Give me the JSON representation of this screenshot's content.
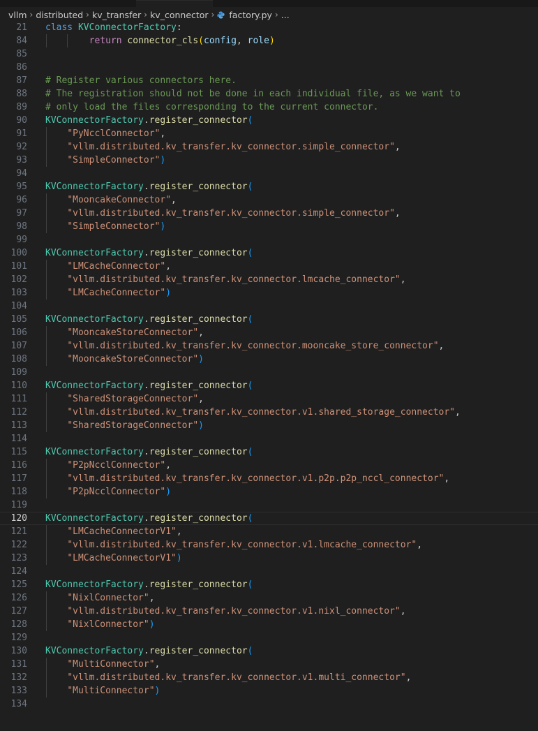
{
  "breadcrumb": [
    "vllm",
    "distributed",
    "kv_transfer",
    "kv_connector",
    "factory.py",
    "..."
  ],
  "colors": {
    "keyword": "#569cd6",
    "control_keyword": "#c586c0",
    "class": "#4ec9b0",
    "function": "#dcdcaa",
    "variable": "#9cdcfe",
    "string": "#ce9178",
    "comment": "#6a9955",
    "background": "#1f1f1f"
  },
  "active_line": "120",
  "sticky": [
    {
      "n": "21",
      "t": [
        [
          "kw",
          "class "
        ],
        [
          "cls",
          "KVConnectorFactory"
        ],
        [
          "txt",
          ":"
        ]
      ]
    },
    {
      "n": "84",
      "t": [
        [
          "txt",
          "        "
        ],
        [
          "kwc",
          "return "
        ],
        [
          "fn",
          "connector_cls"
        ],
        [
          "p0",
          "("
        ],
        [
          "var",
          "config"
        ],
        [
          "txt",
          ", "
        ],
        [
          "var",
          "role"
        ],
        [
          "p0",
          ")"
        ]
      ]
    }
  ],
  "lines": [
    {
      "n": "85",
      "t": []
    },
    {
      "n": "86",
      "t": []
    },
    {
      "n": "87",
      "t": [
        [
          "cmt",
          "# Register various connectors here."
        ]
      ]
    },
    {
      "n": "88",
      "t": [
        [
          "cmt",
          "# The registration should not be done in each individual file, as we want to"
        ]
      ]
    },
    {
      "n": "89",
      "t": [
        [
          "cmt",
          "# only load the files corresponding to the current connector."
        ]
      ]
    },
    {
      "n": "90",
      "t": [
        [
          "cls",
          "KVConnectorFactory"
        ],
        [
          "txt",
          "."
        ],
        [
          "fn",
          "register_connector"
        ],
        [
          "p2",
          "("
        ]
      ]
    },
    {
      "n": "91",
      "t": [
        [
          "txt",
          "    "
        ],
        [
          "str",
          "\"PyNcclConnector\""
        ],
        [
          "txt",
          ","
        ]
      ]
    },
    {
      "n": "92",
      "t": [
        [
          "txt",
          "    "
        ],
        [
          "str",
          "\"vllm.distributed.kv_transfer.kv_connector.simple_connector\""
        ],
        [
          "txt",
          ","
        ]
      ]
    },
    {
      "n": "93",
      "t": [
        [
          "txt",
          "    "
        ],
        [
          "str",
          "\"SimpleConnector\""
        ],
        [
          "p2",
          ")"
        ]
      ]
    },
    {
      "n": "94",
      "t": []
    },
    {
      "n": "95",
      "t": [
        [
          "cls",
          "KVConnectorFactory"
        ],
        [
          "txt",
          "."
        ],
        [
          "fn",
          "register_connector"
        ],
        [
          "p2",
          "("
        ]
      ]
    },
    {
      "n": "96",
      "t": [
        [
          "txt",
          "    "
        ],
        [
          "str",
          "\"MooncakeConnector\""
        ],
        [
          "txt",
          ","
        ]
      ]
    },
    {
      "n": "97",
      "t": [
        [
          "txt",
          "    "
        ],
        [
          "str",
          "\"vllm.distributed.kv_transfer.kv_connector.simple_connector\""
        ],
        [
          "txt",
          ","
        ]
      ]
    },
    {
      "n": "98",
      "t": [
        [
          "txt",
          "    "
        ],
        [
          "str",
          "\"SimpleConnector\""
        ],
        [
          "p2",
          ")"
        ]
      ]
    },
    {
      "n": "99",
      "t": []
    },
    {
      "n": "100",
      "t": [
        [
          "cls",
          "KVConnectorFactory"
        ],
        [
          "txt",
          "."
        ],
        [
          "fn",
          "register_connector"
        ],
        [
          "p2",
          "("
        ]
      ]
    },
    {
      "n": "101",
      "t": [
        [
          "txt",
          "    "
        ],
        [
          "str",
          "\"LMCacheConnector\""
        ],
        [
          "txt",
          ","
        ]
      ]
    },
    {
      "n": "102",
      "t": [
        [
          "txt",
          "    "
        ],
        [
          "str",
          "\"vllm.distributed.kv_transfer.kv_connector.lmcache_connector\""
        ],
        [
          "txt",
          ","
        ]
      ]
    },
    {
      "n": "103",
      "t": [
        [
          "txt",
          "    "
        ],
        [
          "str",
          "\"LMCacheConnector\""
        ],
        [
          "p2",
          ")"
        ]
      ]
    },
    {
      "n": "104",
      "t": []
    },
    {
      "n": "105",
      "t": [
        [
          "cls",
          "KVConnectorFactory"
        ],
        [
          "txt",
          "."
        ],
        [
          "fn",
          "register_connector"
        ],
        [
          "p2",
          "("
        ]
      ]
    },
    {
      "n": "106",
      "t": [
        [
          "txt",
          "    "
        ],
        [
          "str",
          "\"MooncakeStoreConnector\""
        ],
        [
          "txt",
          ","
        ]
      ]
    },
    {
      "n": "107",
      "t": [
        [
          "txt",
          "    "
        ],
        [
          "str",
          "\"vllm.distributed.kv_transfer.kv_connector.mooncake_store_connector\""
        ],
        [
          "txt",
          ","
        ]
      ]
    },
    {
      "n": "108",
      "t": [
        [
          "txt",
          "    "
        ],
        [
          "str",
          "\"MooncakeStoreConnector\""
        ],
        [
          "p2",
          ")"
        ]
      ]
    },
    {
      "n": "109",
      "t": []
    },
    {
      "n": "110",
      "t": [
        [
          "cls",
          "KVConnectorFactory"
        ],
        [
          "txt",
          "."
        ],
        [
          "fn",
          "register_connector"
        ],
        [
          "p2",
          "("
        ]
      ]
    },
    {
      "n": "111",
      "t": [
        [
          "txt",
          "    "
        ],
        [
          "str",
          "\"SharedStorageConnector\""
        ],
        [
          "txt",
          ","
        ]
      ]
    },
    {
      "n": "112",
      "t": [
        [
          "txt",
          "    "
        ],
        [
          "str",
          "\"vllm.distributed.kv_transfer.kv_connector.v1.shared_storage_connector\""
        ],
        [
          "txt",
          ","
        ]
      ]
    },
    {
      "n": "113",
      "t": [
        [
          "txt",
          "    "
        ],
        [
          "str",
          "\"SharedStorageConnector\""
        ],
        [
          "p2",
          ")"
        ]
      ]
    },
    {
      "n": "114",
      "t": []
    },
    {
      "n": "115",
      "t": [
        [
          "cls",
          "KVConnectorFactory"
        ],
        [
          "txt",
          "."
        ],
        [
          "fn",
          "register_connector"
        ],
        [
          "p2",
          "("
        ]
      ]
    },
    {
      "n": "116",
      "t": [
        [
          "txt",
          "    "
        ],
        [
          "str",
          "\"P2pNcclConnector\""
        ],
        [
          "txt",
          ","
        ]
      ]
    },
    {
      "n": "117",
      "t": [
        [
          "txt",
          "    "
        ],
        [
          "str",
          "\"vllm.distributed.kv_transfer.kv_connector.v1.p2p.p2p_nccl_connector\""
        ],
        [
          "txt",
          ","
        ]
      ]
    },
    {
      "n": "118",
      "t": [
        [
          "txt",
          "    "
        ],
        [
          "str",
          "\"P2pNcclConnector\""
        ],
        [
          "p2",
          ")"
        ]
      ]
    },
    {
      "n": "119",
      "t": []
    },
    {
      "n": "120",
      "t": [
        [
          "cls",
          "KVConnectorFactory"
        ],
        [
          "txt",
          "."
        ],
        [
          "fn",
          "register_connector"
        ],
        [
          "p2",
          "("
        ]
      ]
    },
    {
      "n": "121",
      "t": [
        [
          "txt",
          "    "
        ],
        [
          "str",
          "\"LMCacheConnectorV1\""
        ],
        [
          "txt",
          ","
        ]
      ]
    },
    {
      "n": "122",
      "t": [
        [
          "txt",
          "    "
        ],
        [
          "str",
          "\"vllm.distributed.kv_transfer.kv_connector.v1.lmcache_connector\""
        ],
        [
          "txt",
          ","
        ]
      ]
    },
    {
      "n": "123",
      "t": [
        [
          "txt",
          "    "
        ],
        [
          "str",
          "\"LMCacheConnectorV1\""
        ],
        [
          "p2",
          ")"
        ]
      ]
    },
    {
      "n": "124",
      "t": []
    },
    {
      "n": "125",
      "t": [
        [
          "cls",
          "KVConnectorFactory"
        ],
        [
          "txt",
          "."
        ],
        [
          "fn",
          "register_connector"
        ],
        [
          "p2",
          "("
        ]
      ]
    },
    {
      "n": "126",
      "t": [
        [
          "txt",
          "    "
        ],
        [
          "str",
          "\"NixlConnector\""
        ],
        [
          "txt",
          ","
        ]
      ]
    },
    {
      "n": "127",
      "t": [
        [
          "txt",
          "    "
        ],
        [
          "str",
          "\"vllm.distributed.kv_transfer.kv_connector.v1.nixl_connector\""
        ],
        [
          "txt",
          ","
        ]
      ]
    },
    {
      "n": "128",
      "t": [
        [
          "txt",
          "    "
        ],
        [
          "str",
          "\"NixlConnector\""
        ],
        [
          "p2",
          ")"
        ]
      ]
    },
    {
      "n": "129",
      "t": []
    },
    {
      "n": "130",
      "t": [
        [
          "cls",
          "KVConnectorFactory"
        ],
        [
          "txt",
          "."
        ],
        [
          "fn",
          "register_connector"
        ],
        [
          "p2",
          "("
        ]
      ]
    },
    {
      "n": "131",
      "t": [
        [
          "txt",
          "    "
        ],
        [
          "str",
          "\"MultiConnector\""
        ],
        [
          "txt",
          ","
        ]
      ]
    },
    {
      "n": "132",
      "t": [
        [
          "txt",
          "    "
        ],
        [
          "str",
          "\"vllm.distributed.kv_transfer.kv_connector.v1.multi_connector\""
        ],
        [
          "txt",
          ","
        ]
      ]
    },
    {
      "n": "133",
      "t": [
        [
          "txt",
          "    "
        ],
        [
          "str",
          "\"MultiConnector\""
        ],
        [
          "p2",
          ")"
        ]
      ]
    },
    {
      "n": "134",
      "t": []
    }
  ]
}
